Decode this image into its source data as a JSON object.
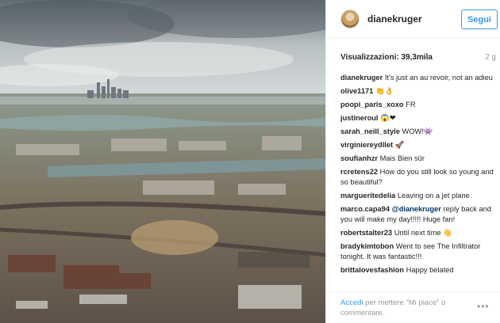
{
  "header": {
    "username": "dianekruger",
    "follow_label": "Segui"
  },
  "stats": {
    "views": "Visualizzazioni: 39,3mila",
    "time": "2 g"
  },
  "comments": [
    {
      "user": "dianekruger",
      "text": "It's just an au revoir, not an adieu"
    },
    {
      "user": "olive1171",
      "text": "👏👌"
    },
    {
      "user": "poopi_paris_xoxo",
      "text": "FR"
    },
    {
      "user": "justineroul",
      "text": "😱❤"
    },
    {
      "user": "sarah_neill_style",
      "text": "WOW!👾"
    },
    {
      "user": "virginiereydllet",
      "text": "🚀"
    },
    {
      "user": "soufianhzr",
      "text": "Mais Bien sûr"
    },
    {
      "user": "rcretens22",
      "text": "How do you still look so young and so beautiful?"
    },
    {
      "user": "margueritedelia",
      "text": "Leaving on a jet plane."
    },
    {
      "user": "marco.capa94",
      "mention": "@dianekruger",
      "text": "reply back and you will make my day!!!!! Huge fan!"
    },
    {
      "user": "robertstalter23",
      "text": "Until next time 👋"
    },
    {
      "user": "bradykimtobon",
      "text": "Went to see The Infiltrator tonight. It was fantastic!!!"
    },
    {
      "user": "brittalovesfashion",
      "text": "Happy belated"
    }
  ],
  "footer": {
    "login_label": "Accedi",
    "text": "per mettere \"Mi piace\" o commentare.",
    "more_icon": "more-options-icon"
  }
}
